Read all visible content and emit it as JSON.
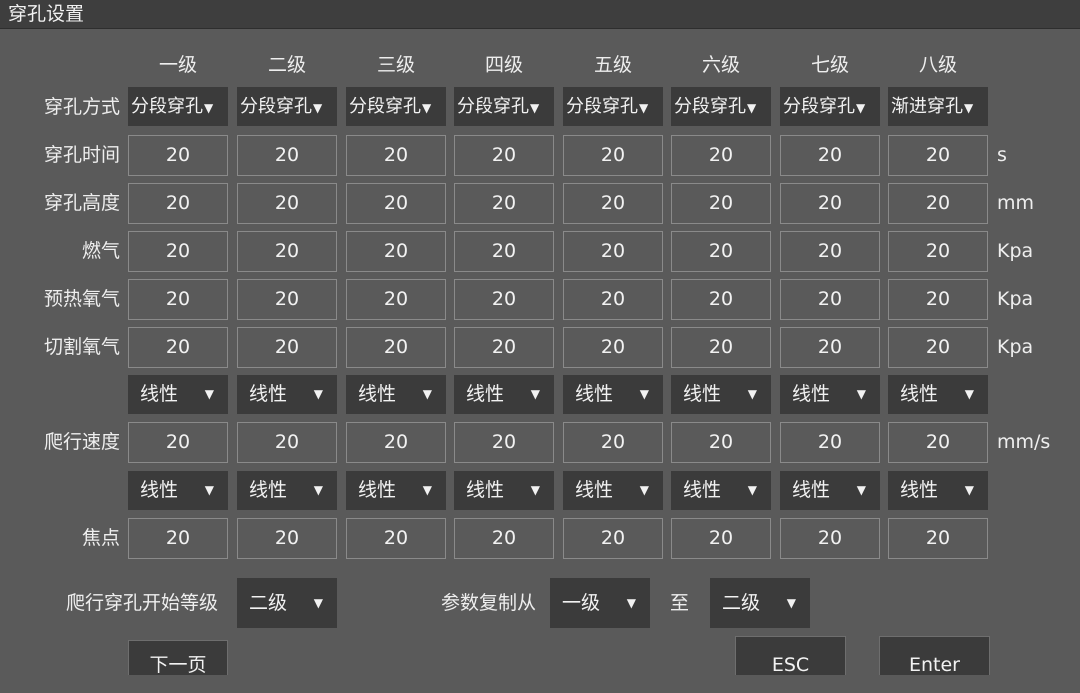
{
  "window": {
    "title": "穿孔设置"
  },
  "levels": [
    "一级",
    "二级",
    "三级",
    "四级",
    "五级",
    "六级",
    "七级",
    "八级"
  ],
  "rows": {
    "method": {
      "label": "穿孔方式",
      "values": [
        "分段穿孔",
        "分段穿孔",
        "分段穿孔",
        "分段穿孔",
        "分段穿孔",
        "分段穿孔",
        "分段穿孔",
        "渐进穿孔"
      ]
    },
    "time": {
      "label": "穿孔时间",
      "unit": "s",
      "values": [
        "20",
        "20",
        "20",
        "20",
        "20",
        "20",
        "20",
        "20"
      ]
    },
    "height": {
      "label": "穿孔高度",
      "unit": "mm",
      "values": [
        "20",
        "20",
        "20",
        "20",
        "20",
        "20",
        "20",
        "20"
      ]
    },
    "gas": {
      "label": "燃气",
      "unit": "Kpa",
      "values": [
        "20",
        "20",
        "20",
        "20",
        "20",
        "20",
        "20",
        "20"
      ]
    },
    "preheat": {
      "label": "预热氧气",
      "unit": "Kpa",
      "values": [
        "20",
        "20",
        "20",
        "20",
        "20",
        "20",
        "20",
        "20"
      ]
    },
    "cut": {
      "label": "切割氧气",
      "unit": "Kpa",
      "values": [
        "20",
        "20",
        "20",
        "20",
        "20",
        "20",
        "20",
        "20"
      ]
    },
    "crawl_mode": {
      "values": [
        "线性",
        "线性",
        "线性",
        "线性",
        "线性",
        "线性",
        "线性",
        "线性"
      ]
    },
    "crawl": {
      "label": "爬行速度",
      "unit": "mm/s",
      "values": [
        "20",
        "20",
        "20",
        "20",
        "20",
        "20",
        "20",
        "20"
      ]
    },
    "focus_mode": {
      "values": [
        "线性",
        "线性",
        "线性",
        "线性",
        "线性",
        "线性",
        "线性",
        "线性"
      ]
    },
    "focus": {
      "label": "焦点",
      "values": [
        "20",
        "20",
        "20",
        "20",
        "20",
        "20",
        "20",
        "20"
      ]
    }
  },
  "bottom": {
    "crawl_start_label": "爬行穿孔开始等级",
    "crawl_start_value": "二级",
    "copy_from_label": "参数复制从",
    "copy_from_value": "一级",
    "to_label": "至",
    "copy_to_value": "二级"
  },
  "buttons": {
    "next_page": "下一页",
    "esc": "ESC",
    "enter": "Enter"
  }
}
